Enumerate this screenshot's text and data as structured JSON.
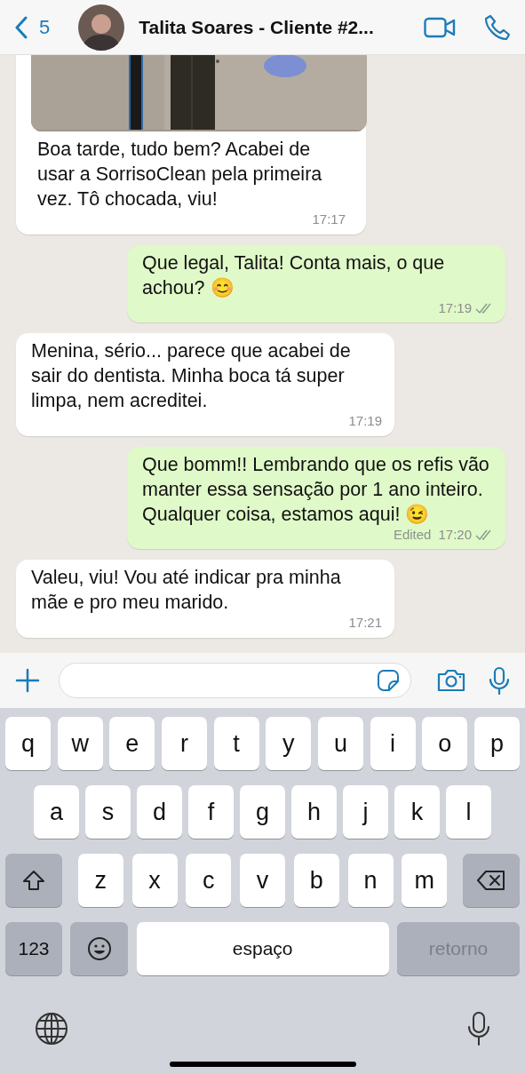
{
  "header": {
    "back_count": "5",
    "title": "Talita Soares - Cliente #2..."
  },
  "messages": [
    {
      "kind": "incoming",
      "text": "Boa tarde, tudo bem? Acabei de usar a SorrisoClean pela primeira vez. Tô chocada, viu!",
      "time": "17:17"
    },
    {
      "kind": "outgoing",
      "text": "Que legal, Talita! Conta mais, o que achou? 😊",
      "time": "17:19",
      "read": false
    },
    {
      "kind": "incoming",
      "text": "Menina, sério... parece que acabei de sair do dentista. Minha boca tá super limpa, nem acreditei.",
      "time": "17:19"
    },
    {
      "kind": "outgoing",
      "text": "Que bomm!! Lembrando que os refis vão manter essa sensação por 1 ano inteiro. Qualquer coisa, estamos aqui! 😉",
      "edited": "Edited",
      "time": "17:20",
      "read": false
    },
    {
      "kind": "incoming",
      "text": "Valeu, viu! Vou até indicar pra minha mãe e pro meu marido.",
      "time": "17:21"
    }
  ],
  "keyboard": {
    "rows": [
      {
        "keys": [
          {
            "kind": "letter",
            "label": "q"
          },
          {
            "kind": "letter",
            "label": "w"
          },
          {
            "kind": "letter",
            "label": "e"
          },
          {
            "kind": "letter",
            "label": "r"
          },
          {
            "kind": "letter",
            "label": "t"
          },
          {
            "kind": "letter",
            "label": "y"
          },
          {
            "kind": "letter",
            "label": "u"
          },
          {
            "kind": "letter",
            "label": "i"
          },
          {
            "kind": "letter",
            "label": "o"
          },
          {
            "kind": "letter",
            "label": "p"
          }
        ]
      },
      {
        "keys": [
          {
            "kind": "letter",
            "label": "a"
          },
          {
            "kind": "letter",
            "label": "s"
          },
          {
            "kind": "letter",
            "label": "d"
          },
          {
            "kind": "letter",
            "label": "f"
          },
          {
            "kind": "letter",
            "label": "g"
          },
          {
            "kind": "letter",
            "label": "h"
          },
          {
            "kind": "letter",
            "label": "j"
          },
          {
            "kind": "letter",
            "label": "k"
          },
          {
            "kind": "letter",
            "label": "l"
          }
        ]
      },
      {
        "keys": [
          {
            "kind": "shift"
          },
          {
            "kind": "letter",
            "label": "z"
          },
          {
            "kind": "letter",
            "label": "x"
          },
          {
            "kind": "letter",
            "label": "c"
          },
          {
            "kind": "letter",
            "label": "v"
          },
          {
            "kind": "letter",
            "label": "b"
          },
          {
            "kind": "letter",
            "label": "n"
          },
          {
            "kind": "letter",
            "label": "m"
          },
          {
            "kind": "backspace"
          }
        ]
      },
      {
        "keys": [
          {
            "kind": "numbers",
            "label": "123"
          },
          {
            "kind": "emoji"
          },
          {
            "kind": "space",
            "label": "espaço"
          },
          {
            "kind": "return",
            "label": "retorno",
            "disabled": true
          }
        ]
      }
    ]
  }
}
